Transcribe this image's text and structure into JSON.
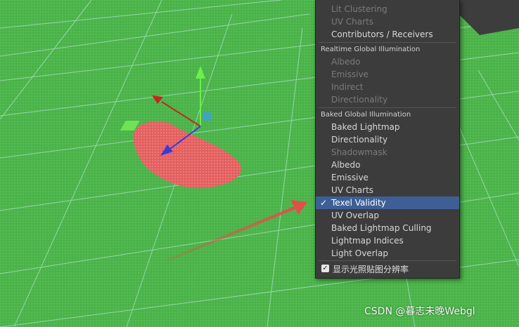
{
  "menu": {
    "items_top": [
      {
        "label": "Lit Clustering",
        "disabled": true
      },
      {
        "label": "UV Charts",
        "disabled": true
      },
      {
        "label": "Contributors / Receivers",
        "disabled": false
      }
    ],
    "realtime_header": "Realtime Global Illumination",
    "realtime_items": [
      {
        "label": "Albedo",
        "disabled": true
      },
      {
        "label": "Emissive",
        "disabled": true
      },
      {
        "label": "Indirect",
        "disabled": true
      },
      {
        "label": "Directionality",
        "disabled": true
      }
    ],
    "baked_header": "Baked Global Illumination",
    "baked_items": [
      {
        "label": "Baked Lightmap",
        "disabled": false
      },
      {
        "label": "Directionality",
        "disabled": false
      },
      {
        "label": "Shadowmask",
        "disabled": true
      },
      {
        "label": "Albedo",
        "disabled": false
      },
      {
        "label": "Emissive",
        "disabled": false
      },
      {
        "label": "UV Charts",
        "disabled": false
      },
      {
        "label": "Texel Validity",
        "disabled": false,
        "selected": true
      },
      {
        "label": "UV Overlap",
        "disabled": false
      },
      {
        "label": "Baked Lightmap Culling",
        "disabled": false
      },
      {
        "label": "Lightmap Indices",
        "disabled": false
      },
      {
        "label": "Light Overlap",
        "disabled": false
      }
    ],
    "check_glyph": "✓",
    "toggle_label": "显示光照贴图分辨率",
    "toggle_checked": true
  },
  "watermark": "CSDN @暮志未晚Webgl",
  "colors": {
    "ground": "#4cb24a",
    "grid": "#8fd6a8",
    "invalid_texel": "#e26060",
    "menu_bg": "#3c3c3c",
    "selection": "#3e5f96",
    "arrow": "#e84a45"
  },
  "scene_icons": [
    "transform-gizmo-icon",
    "red-arrow-annotation"
  ]
}
